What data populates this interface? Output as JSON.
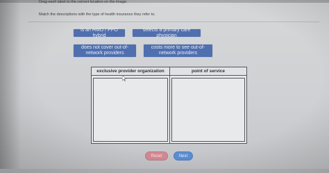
{
  "instruction": "Drag each label to the correct location on the image.",
  "subinstruction": "Match the descriptions with the type of health insurance they refer to.",
  "labels": [
    {
      "text": "is an HMO / PPO hybrid"
    },
    {
      "text": "selects a primary care physician"
    },
    {
      "text": "does not cover out-of-network providers"
    },
    {
      "text": "costs more to see out-of-network providers"
    }
  ],
  "table": {
    "columns": [
      "exclusive provider organization",
      "point of service"
    ]
  },
  "buttons": {
    "reset": "Reset",
    "next": "Next"
  },
  "colors": {
    "label_bg": "#4f6fae",
    "reset_bg": "#d48a95",
    "next_bg": "#5b8fd0"
  }
}
